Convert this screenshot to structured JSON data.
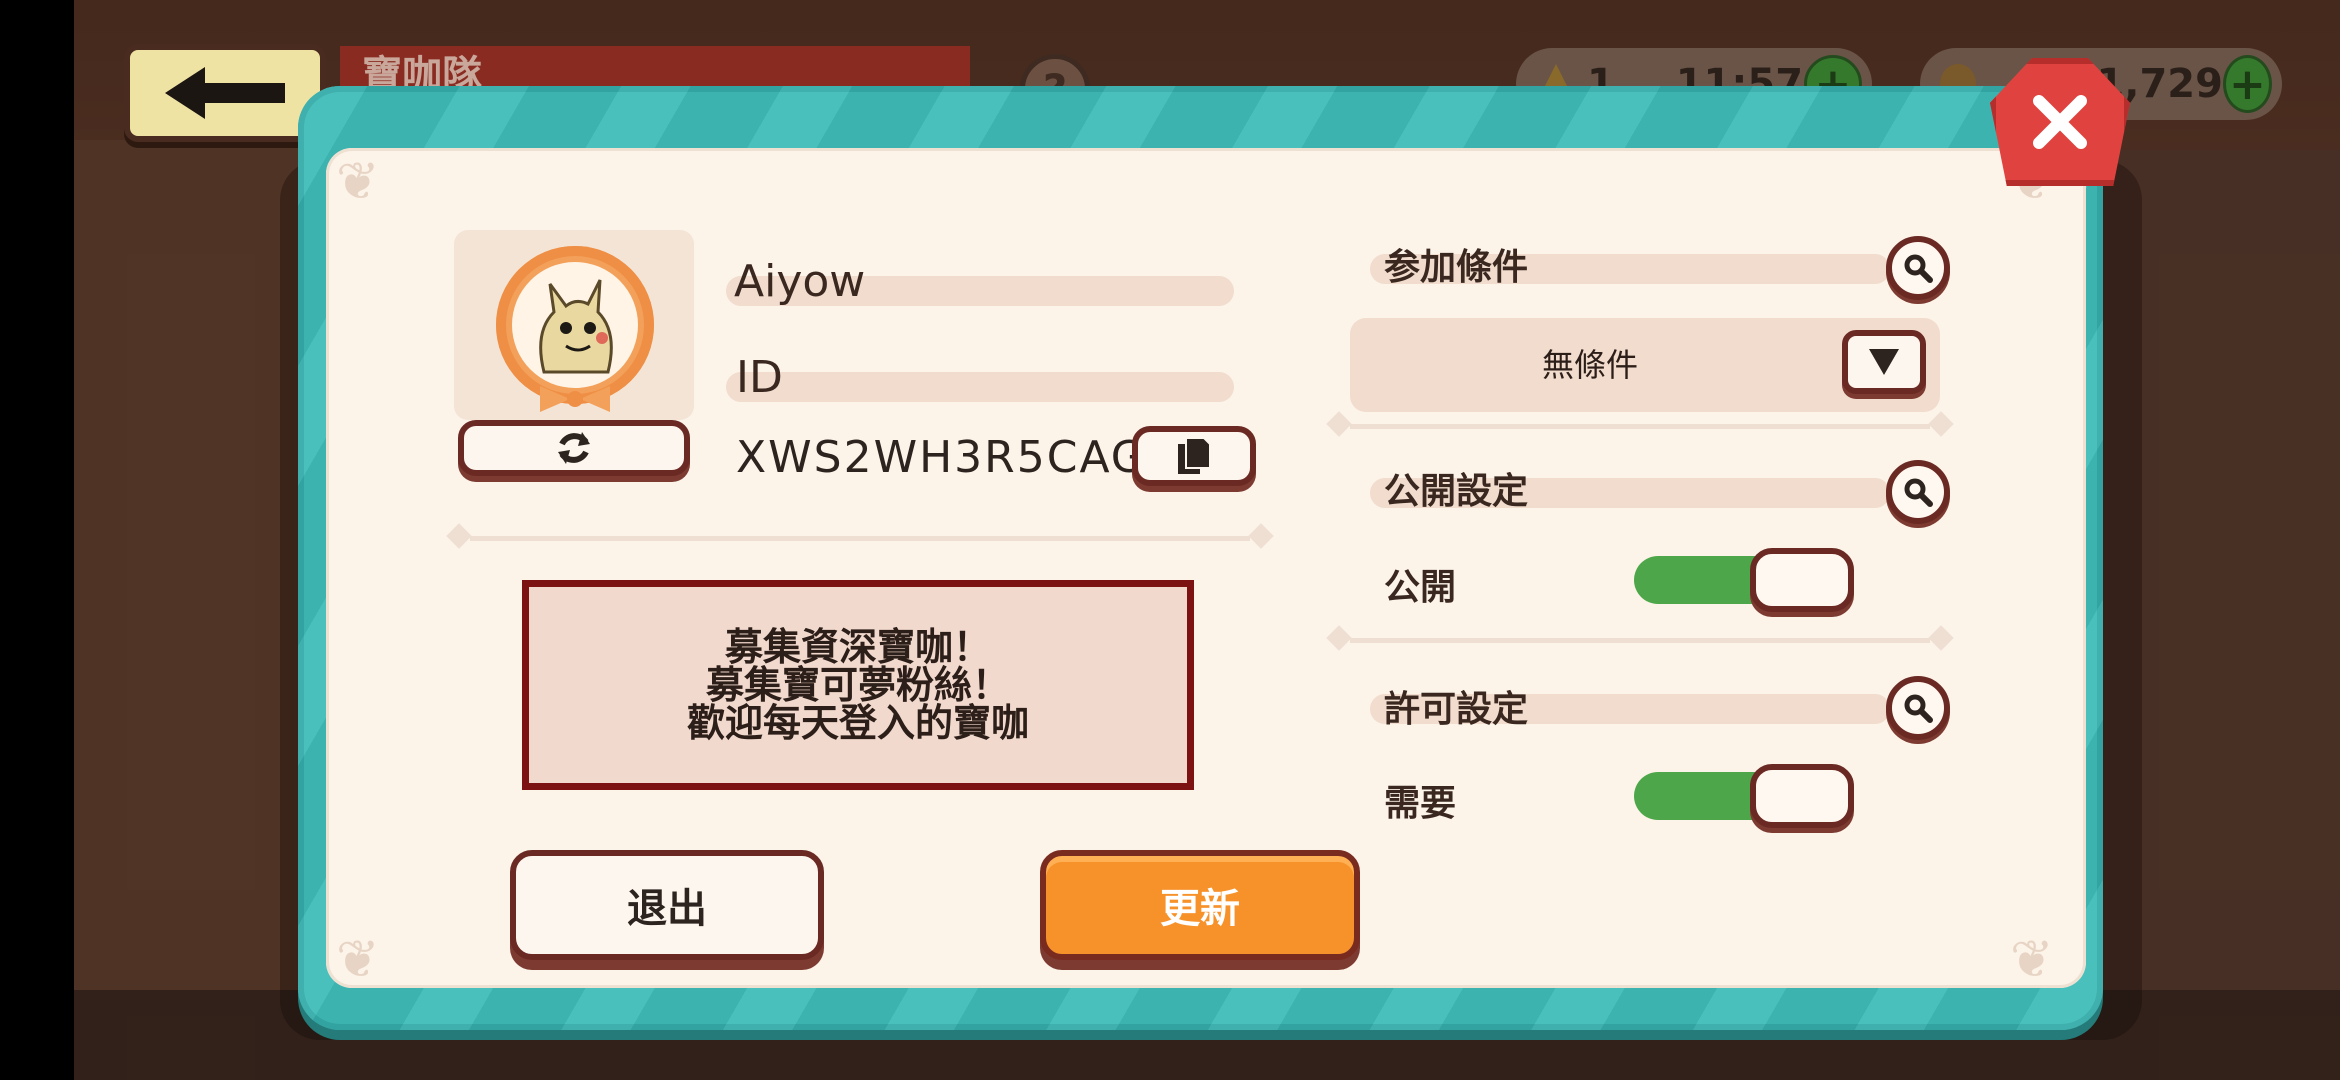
{
  "hud": {
    "banner_text": "寶咖隊",
    "help_label": "?",
    "stamina_count": "1",
    "timer": "11:57",
    "coins": "1,729",
    "plus_label": "+"
  },
  "profile": {
    "name": "Aiyow",
    "id_label": "ID",
    "id_value": "XWS2WH3R5CAG"
  },
  "message": {
    "lines": [
      "募集資深寶咖！",
      "募集寶可夢粉絲！",
      "歡迎每天登入的寶咖"
    ]
  },
  "buttons": {
    "exit_label": "退出",
    "update_label": "更新"
  },
  "settings": {
    "join_condition_label": "参加條件",
    "join_condition_value": "無條件",
    "visibility_label": "公開設定",
    "visibility_value": "公開",
    "visibility_on": true,
    "permission_label": "許可設定",
    "permission_value": "需要",
    "permission_on": true
  },
  "colors": {
    "accent_orange": "#f7922a",
    "toggle_green": "#4ea64a",
    "frame_teal": "#3fb8b4",
    "close_red": "#e0433f"
  },
  "icons": [
    "back-arrow-icon",
    "help-icon",
    "stamina-icon",
    "coin-icon",
    "close-icon",
    "refresh-icon",
    "copy-icon",
    "search-icon",
    "chevron-down-icon"
  ]
}
